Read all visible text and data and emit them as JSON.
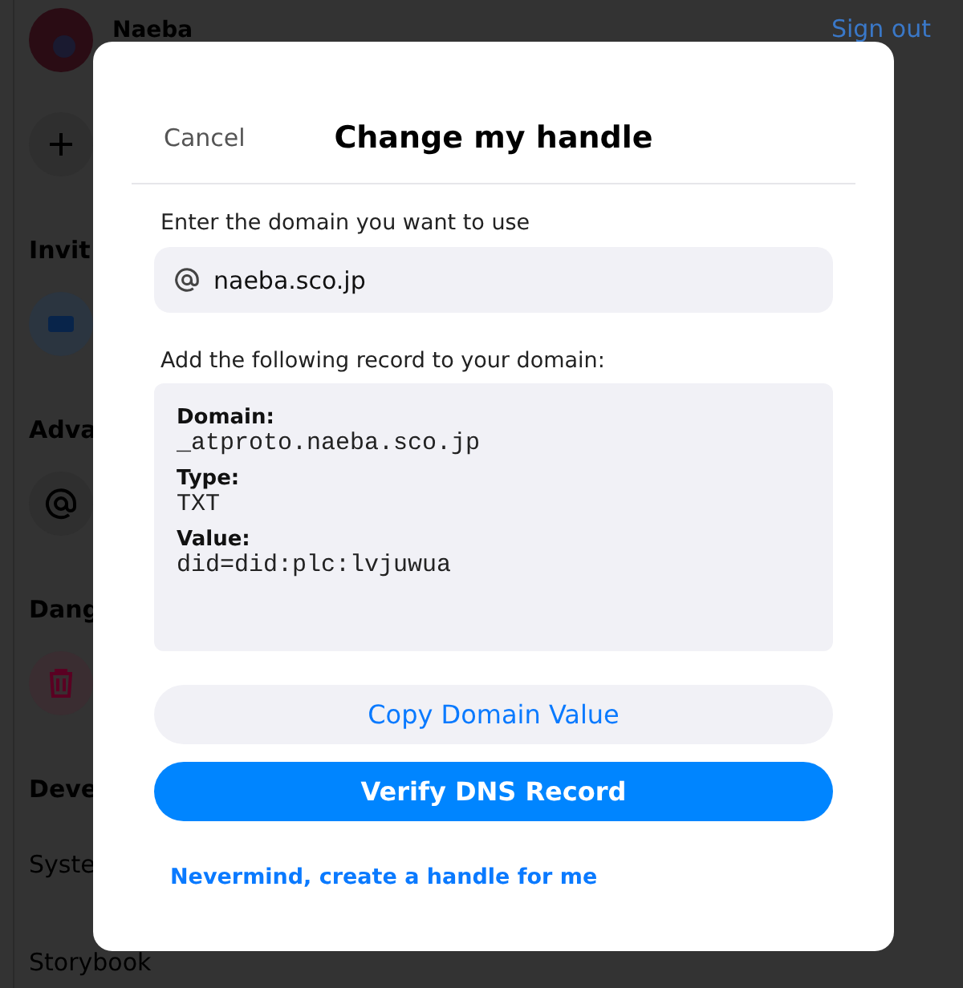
{
  "background": {
    "profile": {
      "name": "Naeba"
    },
    "sign_out": "Sign out",
    "sections": [
      {
        "kind": "heading",
        "label": "Invit"
      },
      {
        "kind": "heading",
        "label": "Adva"
      },
      {
        "kind": "heading",
        "label": "Dang"
      },
      {
        "kind": "heading",
        "label": "Deve"
      },
      {
        "kind": "item",
        "label": "Syste"
      },
      {
        "kind": "item",
        "label": "Storybook"
      }
    ]
  },
  "dialog": {
    "cancel": "Cancel",
    "title": "Change my handle",
    "domain_label": "Enter the domain you want to use",
    "domain_value": "naeba.sco.jp",
    "record_label": "Add the following record to your domain:",
    "record": [
      {
        "label": "Domain:",
        "value": "_atproto.naeba.sco.jp"
      },
      {
        "label": "Type:",
        "value": "TXT"
      },
      {
        "label": "Value:",
        "value": "did=did:plc:lvjuwua"
      }
    ],
    "copy_button": "Copy Domain Value",
    "verify_button": "Verify DNS Record",
    "alt_link": "Nevermind, create a handle for me"
  }
}
